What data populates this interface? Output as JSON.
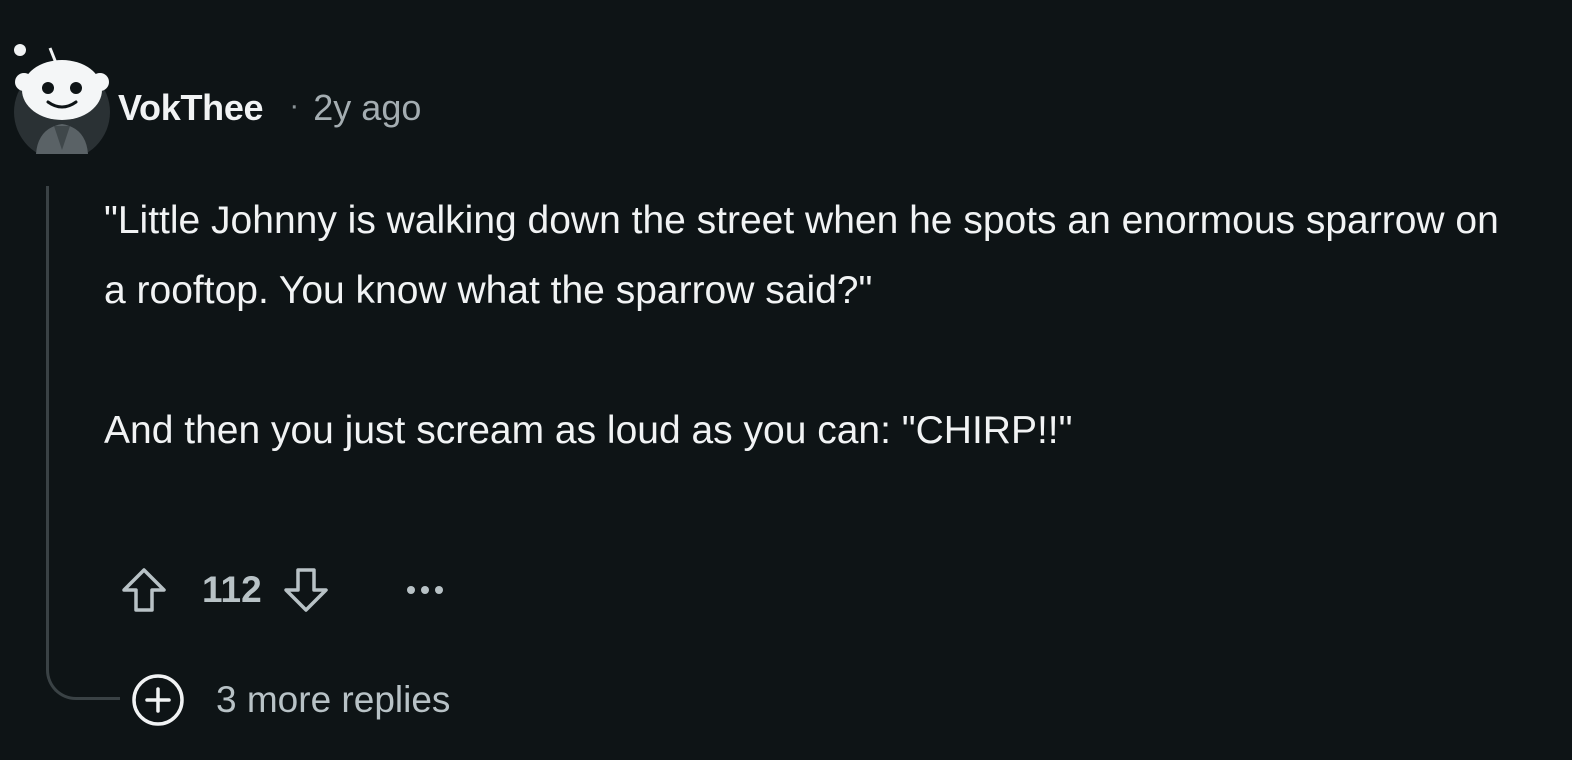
{
  "comment": {
    "author": "VokThee",
    "separator": "·",
    "time": "2y ago",
    "paragraphs": [
      "\"Little Johnny is walking down the street when he spots an enormous sparrow on a rooftop. You know what the sparrow said?\"",
      "And then you just scream as loud as you can: \"CHIRP!!\""
    ],
    "score": "112",
    "replies_label": "3 more replies"
  },
  "icons": {
    "avatar": "snoo-avatar",
    "upvote": "upvote-arrow-icon",
    "downvote": "downvote-arrow-icon",
    "more": "more-options-icon",
    "expand": "expand-plus-icon"
  },
  "colors": {
    "background": "#0e1416",
    "text": "#f1f3f4",
    "muted": "#a4adb1",
    "thread_line": "#3a4245"
  }
}
